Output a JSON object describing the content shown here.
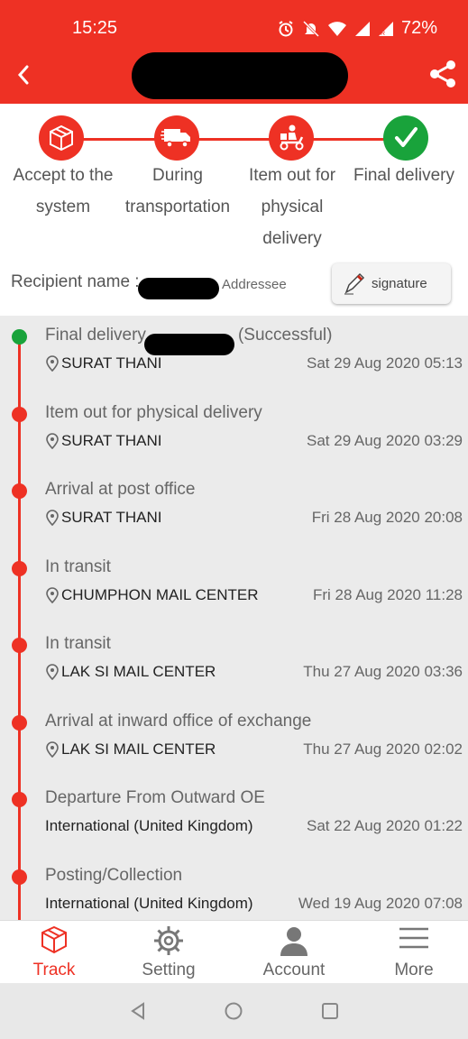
{
  "status_bar": {
    "time": "15:25",
    "battery": "72%"
  },
  "header": {
    "back_icon": "chevron-left-icon",
    "share_icon": "share-icon",
    "accent_color": "#ee3124"
  },
  "stepper": [
    {
      "label": "Accept to the system",
      "icon": "box-icon"
    },
    {
      "label": "During transportation",
      "icon": "truck-icon"
    },
    {
      "label": "Item out for physical delivery",
      "icon": "scooter-icon"
    },
    {
      "label": "Final delivery",
      "icon": "check-icon",
      "done_color": "#19a33b"
    }
  ],
  "recipient": {
    "label": "Recipient name :",
    "suffix": "Addressee",
    "signature_label": "signature"
  },
  "events": [
    {
      "title": "Final delivery",
      "title_suffix": "(Successful)",
      "location": "SURAT THANI",
      "date": "Sat 29 Aug 2020 05:13",
      "has_pin": true
    },
    {
      "title": "Item out for physical delivery",
      "location": "SURAT THANI",
      "date": "Sat 29 Aug 2020 03:29",
      "has_pin": true
    },
    {
      "title": "Arrival at post office",
      "location": "SURAT THANI",
      "date": "Fri 28 Aug 2020 20:08",
      "has_pin": true
    },
    {
      "title": "In transit",
      "location": "CHUMPHON MAIL CENTER",
      "date": "Fri 28 Aug 2020 11:28",
      "has_pin": true
    },
    {
      "title": "In transit",
      "location": "LAK SI MAIL CENTER",
      "date": "Thu 27 Aug 2020 03:36",
      "has_pin": true
    },
    {
      "title": "Arrival at inward office of exchange",
      "location": "LAK SI MAIL CENTER",
      "date": "Thu 27 Aug 2020 02:02",
      "has_pin": true
    },
    {
      "title": "Departure From Outward OE",
      "location": "International (United Kingdom)",
      "date": "Sat 22 Aug 2020 01:22",
      "has_pin": false
    },
    {
      "title": "Posting/Collection",
      "location": "International (United Kingdom)",
      "date": "Wed 19 Aug 2020 07:08",
      "has_pin": false
    }
  ],
  "bottom_nav": [
    {
      "label": "Track",
      "icon": "box-icon",
      "active": true
    },
    {
      "label": "Setting",
      "icon": "gear-icon",
      "active": false
    },
    {
      "label": "Account",
      "icon": "user-icon",
      "active": false
    },
    {
      "label": "More",
      "icon": "menu-icon",
      "active": false
    }
  ]
}
